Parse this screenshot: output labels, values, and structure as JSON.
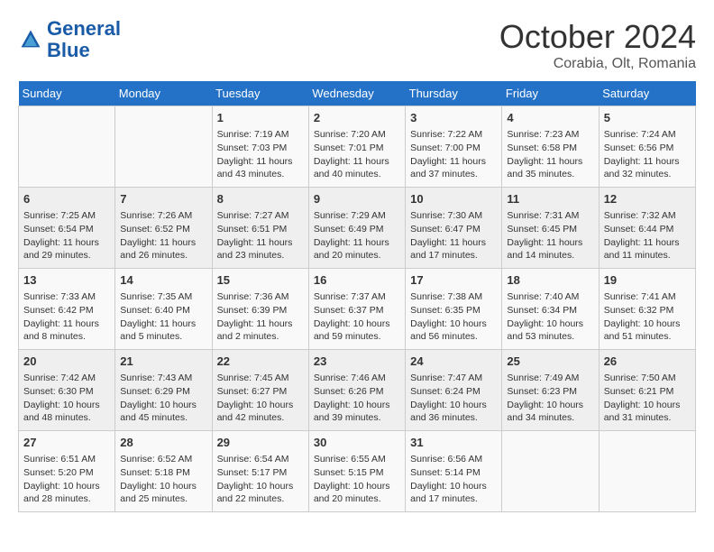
{
  "header": {
    "logo_line1": "General",
    "logo_line2": "Blue",
    "month": "October 2024",
    "location": "Corabia, Olt, Romania"
  },
  "days_of_week": [
    "Sunday",
    "Monday",
    "Tuesday",
    "Wednesday",
    "Thursday",
    "Friday",
    "Saturday"
  ],
  "weeks": [
    [
      {
        "day": "",
        "content": ""
      },
      {
        "day": "",
        "content": ""
      },
      {
        "day": "1",
        "content": "Sunrise: 7:19 AM\nSunset: 7:03 PM\nDaylight: 11 hours\nand 43 minutes."
      },
      {
        "day": "2",
        "content": "Sunrise: 7:20 AM\nSunset: 7:01 PM\nDaylight: 11 hours\nand 40 minutes."
      },
      {
        "day": "3",
        "content": "Sunrise: 7:22 AM\nSunset: 7:00 PM\nDaylight: 11 hours\nand 37 minutes."
      },
      {
        "day": "4",
        "content": "Sunrise: 7:23 AM\nSunset: 6:58 PM\nDaylight: 11 hours\nand 35 minutes."
      },
      {
        "day": "5",
        "content": "Sunrise: 7:24 AM\nSunset: 6:56 PM\nDaylight: 11 hours\nand 32 minutes."
      }
    ],
    [
      {
        "day": "6",
        "content": "Sunrise: 7:25 AM\nSunset: 6:54 PM\nDaylight: 11 hours\nand 29 minutes."
      },
      {
        "day": "7",
        "content": "Sunrise: 7:26 AM\nSunset: 6:52 PM\nDaylight: 11 hours\nand 26 minutes."
      },
      {
        "day": "8",
        "content": "Sunrise: 7:27 AM\nSunset: 6:51 PM\nDaylight: 11 hours\nand 23 minutes."
      },
      {
        "day": "9",
        "content": "Sunrise: 7:29 AM\nSunset: 6:49 PM\nDaylight: 11 hours\nand 20 minutes."
      },
      {
        "day": "10",
        "content": "Sunrise: 7:30 AM\nSunset: 6:47 PM\nDaylight: 11 hours\nand 17 minutes."
      },
      {
        "day": "11",
        "content": "Sunrise: 7:31 AM\nSunset: 6:45 PM\nDaylight: 11 hours\nand 14 minutes."
      },
      {
        "day": "12",
        "content": "Sunrise: 7:32 AM\nSunset: 6:44 PM\nDaylight: 11 hours\nand 11 minutes."
      }
    ],
    [
      {
        "day": "13",
        "content": "Sunrise: 7:33 AM\nSunset: 6:42 PM\nDaylight: 11 hours\nand 8 minutes."
      },
      {
        "day": "14",
        "content": "Sunrise: 7:35 AM\nSunset: 6:40 PM\nDaylight: 11 hours\nand 5 minutes."
      },
      {
        "day": "15",
        "content": "Sunrise: 7:36 AM\nSunset: 6:39 PM\nDaylight: 11 hours\nand 2 minutes."
      },
      {
        "day": "16",
        "content": "Sunrise: 7:37 AM\nSunset: 6:37 PM\nDaylight: 10 hours\nand 59 minutes."
      },
      {
        "day": "17",
        "content": "Sunrise: 7:38 AM\nSunset: 6:35 PM\nDaylight: 10 hours\nand 56 minutes."
      },
      {
        "day": "18",
        "content": "Sunrise: 7:40 AM\nSunset: 6:34 PM\nDaylight: 10 hours\nand 53 minutes."
      },
      {
        "day": "19",
        "content": "Sunrise: 7:41 AM\nSunset: 6:32 PM\nDaylight: 10 hours\nand 51 minutes."
      }
    ],
    [
      {
        "day": "20",
        "content": "Sunrise: 7:42 AM\nSunset: 6:30 PM\nDaylight: 10 hours\nand 48 minutes."
      },
      {
        "day": "21",
        "content": "Sunrise: 7:43 AM\nSunset: 6:29 PM\nDaylight: 10 hours\nand 45 minutes."
      },
      {
        "day": "22",
        "content": "Sunrise: 7:45 AM\nSunset: 6:27 PM\nDaylight: 10 hours\nand 42 minutes."
      },
      {
        "day": "23",
        "content": "Sunrise: 7:46 AM\nSunset: 6:26 PM\nDaylight: 10 hours\nand 39 minutes."
      },
      {
        "day": "24",
        "content": "Sunrise: 7:47 AM\nSunset: 6:24 PM\nDaylight: 10 hours\nand 36 minutes."
      },
      {
        "day": "25",
        "content": "Sunrise: 7:49 AM\nSunset: 6:23 PM\nDaylight: 10 hours\nand 34 minutes."
      },
      {
        "day": "26",
        "content": "Sunrise: 7:50 AM\nSunset: 6:21 PM\nDaylight: 10 hours\nand 31 minutes."
      }
    ],
    [
      {
        "day": "27",
        "content": "Sunrise: 6:51 AM\nSunset: 5:20 PM\nDaylight: 10 hours\nand 28 minutes."
      },
      {
        "day": "28",
        "content": "Sunrise: 6:52 AM\nSunset: 5:18 PM\nDaylight: 10 hours\nand 25 minutes."
      },
      {
        "day": "29",
        "content": "Sunrise: 6:54 AM\nSunset: 5:17 PM\nDaylight: 10 hours\nand 22 minutes."
      },
      {
        "day": "30",
        "content": "Sunrise: 6:55 AM\nSunset: 5:15 PM\nDaylight: 10 hours\nand 20 minutes."
      },
      {
        "day": "31",
        "content": "Sunrise: 6:56 AM\nSunset: 5:14 PM\nDaylight: 10 hours\nand 17 minutes."
      },
      {
        "day": "",
        "content": ""
      },
      {
        "day": "",
        "content": ""
      }
    ]
  ]
}
